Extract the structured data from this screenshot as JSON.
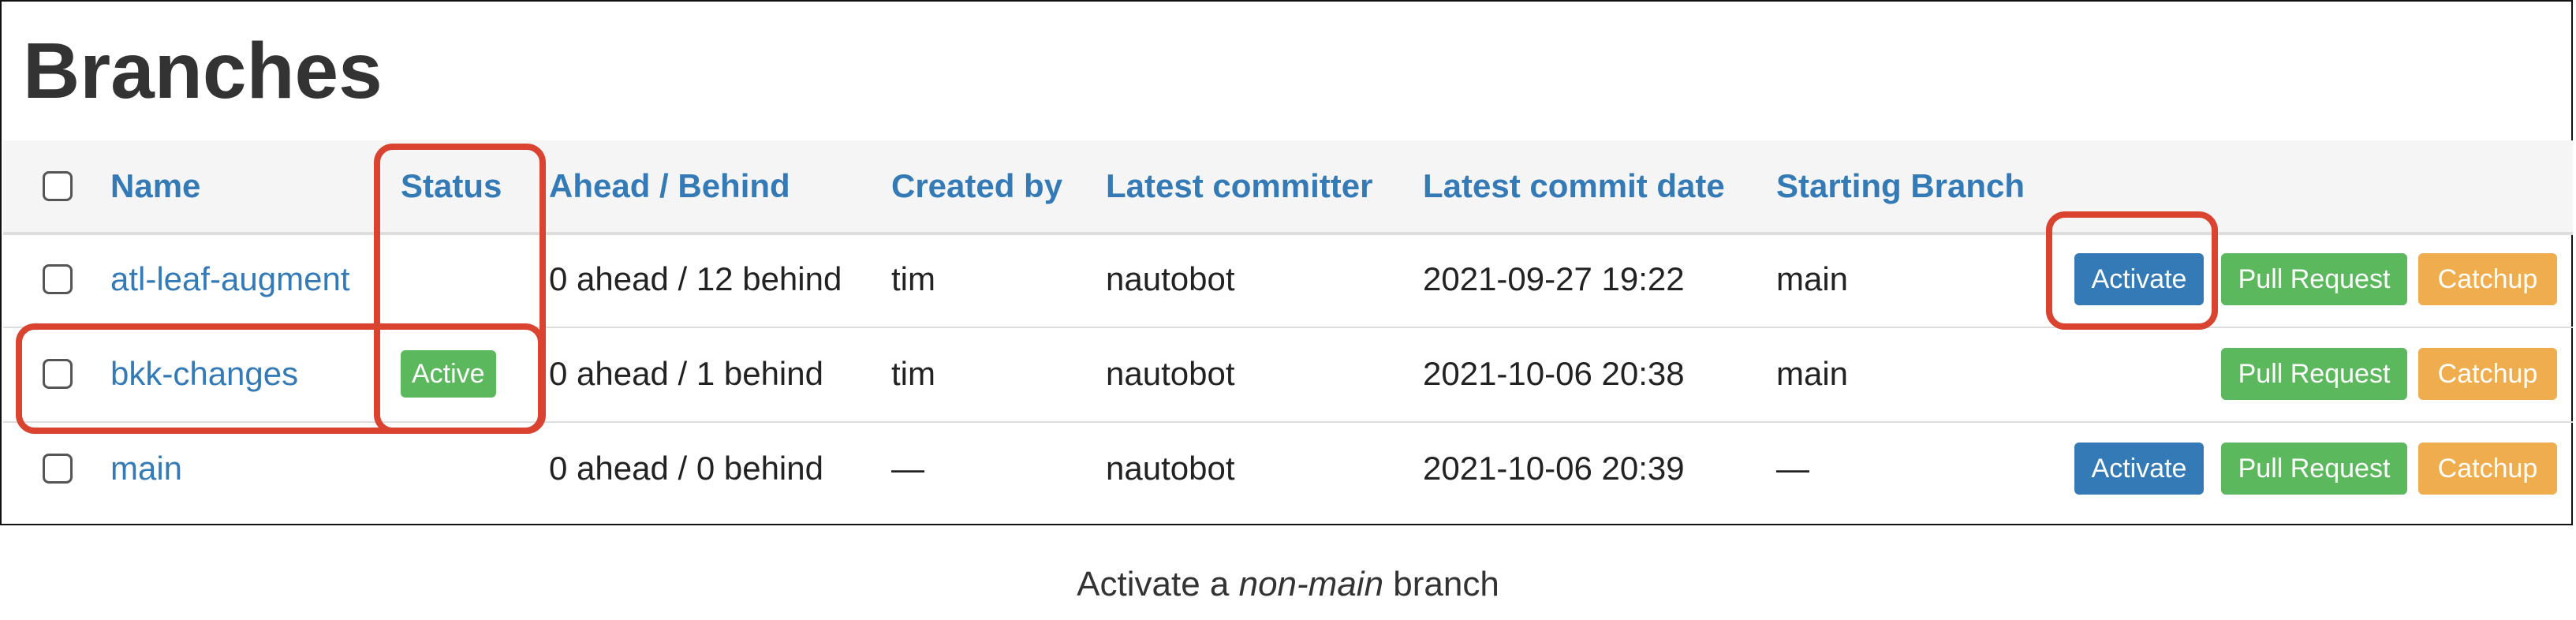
{
  "page": {
    "title": "Branches",
    "caption": {
      "prefix": "Activate a ",
      "emphasis": "non-main",
      "suffix": " branch"
    }
  },
  "table": {
    "columns": [
      "Name",
      "Status",
      "Ahead / Behind",
      "Created by",
      "Latest committer",
      "Latest commit date",
      "Starting Branch"
    ],
    "rows": [
      {
        "name": "atl-leaf-augment",
        "status": "",
        "ahead_behind": "0 ahead / 12 behind",
        "created_by": "tim",
        "latest_committer": "nautobot",
        "latest_commit_date": "2021-09-27 19:22",
        "starting_branch": "main"
      },
      {
        "name": "bkk-changes",
        "status": "Active",
        "ahead_behind": "0 ahead / 1 behind",
        "created_by": "tim",
        "latest_committer": "nautobot",
        "latest_commit_date": "2021-10-06 20:38",
        "starting_branch": "main"
      },
      {
        "name": "main",
        "status": "",
        "ahead_behind": "0 ahead / 0 behind",
        "created_by": "—",
        "latest_committer": "nautobot",
        "latest_commit_date": "2021-10-06 20:39",
        "starting_branch": "—"
      }
    ]
  },
  "actions": {
    "activate": "Activate",
    "pull_request": "Pull Request",
    "catchup": "Catchup"
  },
  "colors": {
    "link": "#337ab7",
    "success": "#5cb85c",
    "warning": "#f0ad4e",
    "annotation": "#d9432f"
  }
}
